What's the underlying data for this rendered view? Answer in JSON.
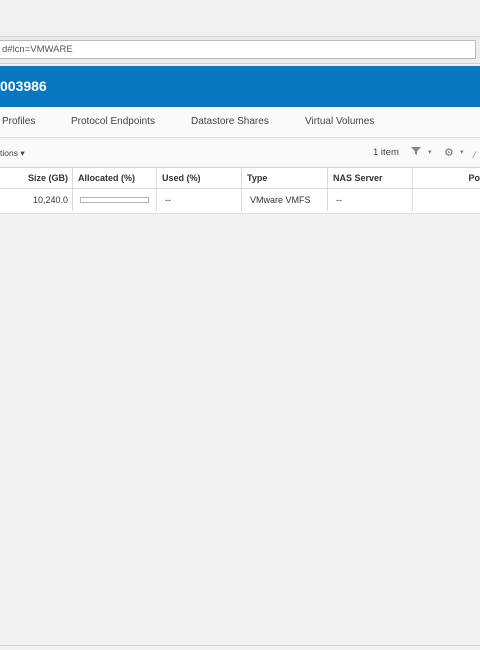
{
  "browser": {
    "address": "d#lcn=VMWARE"
  },
  "banner": {
    "title": "003986"
  },
  "tabs": [
    {
      "label": "Profiles"
    },
    {
      "label": "Protocol Endpoints"
    },
    {
      "label": "Datastore Shares"
    },
    {
      "label": "Virtual Volumes"
    }
  ],
  "toolbar": {
    "actions_label": "tions ▾",
    "item_count": "1 item",
    "filter_icon": "filter-icon",
    "settings_icon": "gear-icon"
  },
  "table": {
    "columns": [
      "Size (GB)",
      "Allocated (%)",
      "Used (%)",
      "Type",
      "NAS Server",
      "Po"
    ],
    "rows": [
      {
        "size": "10,240.0",
        "allocated_fraction": 0,
        "used": "--",
        "type": "VMware VMFS",
        "nas_server": "--",
        "pool": ""
      }
    ]
  },
  "colors": {
    "banner": "#0778c0",
    "progress": "#2e8bcc"
  }
}
